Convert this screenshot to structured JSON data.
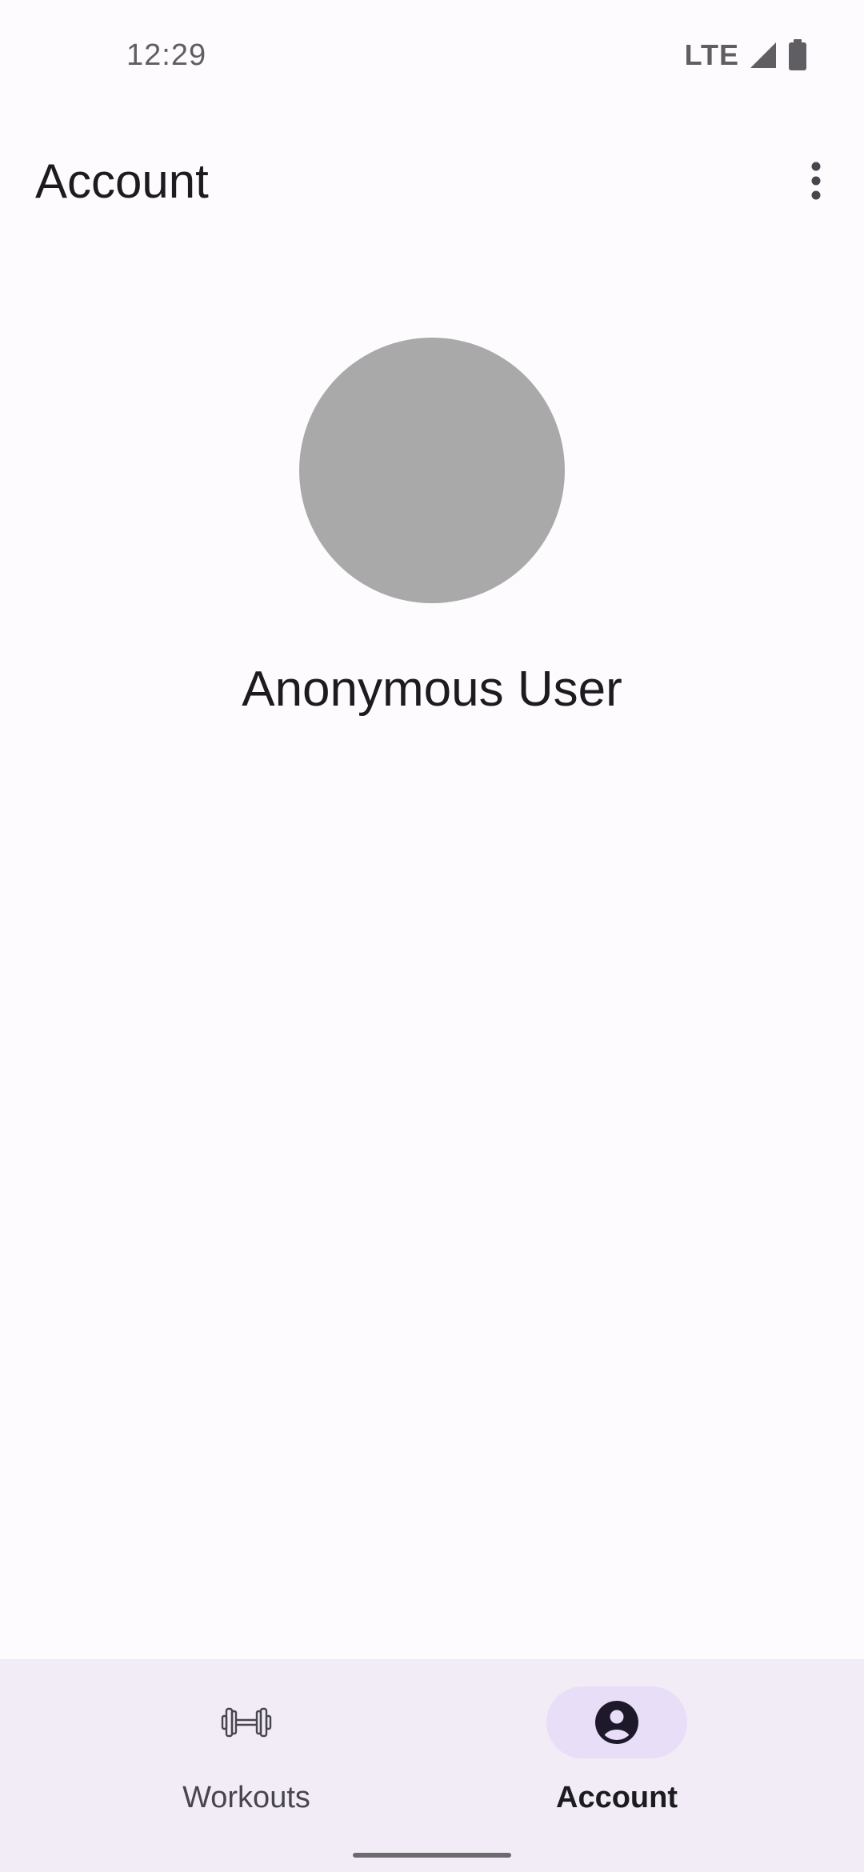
{
  "status_bar": {
    "time": "12:29",
    "network": "LTE",
    "signal_icon": "signal-icon",
    "battery_icon": "battery-icon"
  },
  "top_app_bar": {
    "title": "Account",
    "overflow_icon": "more-vert-icon"
  },
  "profile": {
    "avatar_color": "#A9A9A9",
    "name": "Anonymous User"
  },
  "bottom_nav": {
    "items": [
      {
        "label": "Workouts",
        "icon": "dumbbell-icon",
        "selected": false
      },
      {
        "label": "Account",
        "icon": "account-circle-icon",
        "selected": true
      }
    ],
    "indicator_color": "#E8DEF8",
    "background_color": "#F1ECF5"
  },
  "colors": {
    "background": "#FEFBFF",
    "text_primary": "#1C1B1F",
    "text_secondary": "#49454F"
  }
}
